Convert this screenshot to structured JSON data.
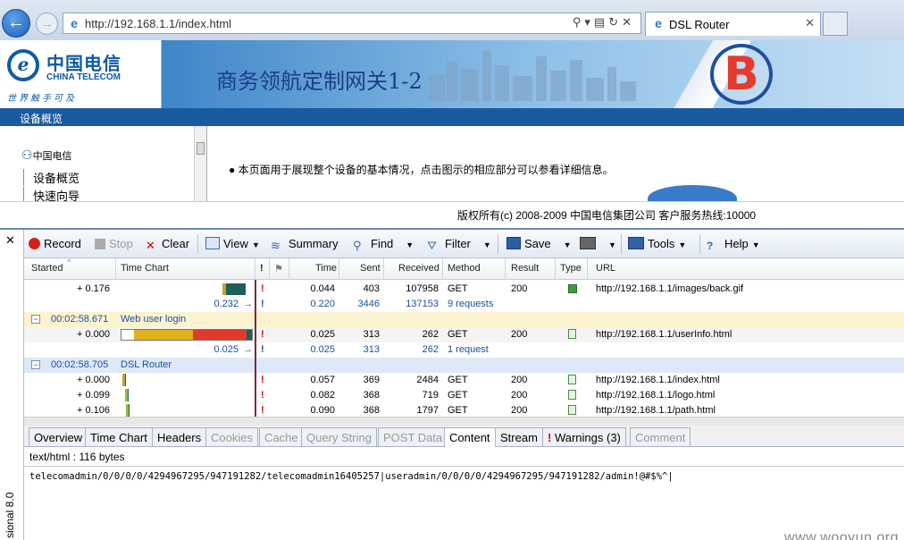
{
  "browser": {
    "url": "http://192.168.1.1/index.html",
    "tab_title": "DSL Router"
  },
  "router": {
    "logo_cn": "中国电信",
    "logo_en": "CHINA TELECOM",
    "logo_sub": "世界触手可及",
    "banner_title": "商务领航定制网关1-2",
    "nav_label": "设备概览",
    "sidebar": {
      "root": "中国电信",
      "items": [
        "设备概览",
        "快速向导"
      ]
    },
    "main_text": "本页面用于展现整个设备的基本情况，点击图示的相应部分可以参看详细信息。",
    "footer": "版权所有(c) 2008-2009 中国电信集团公司 客户服务热线:10000"
  },
  "fiddler": {
    "toolbar": {
      "record": "Record",
      "stop": "Stop",
      "clear": "Clear",
      "view": "View",
      "summary": "Summary",
      "find": "Find",
      "filter": "Filter",
      "save": "Save",
      "tools": "Tools",
      "help": "Help"
    },
    "columns": {
      "started": "Started",
      "time_chart": "Time Chart",
      "time": "Time",
      "sent": "Sent",
      "received": "Received",
      "method": "Method",
      "result": "Result",
      "type": "Type",
      "url": "URL"
    },
    "rows": [
      {
        "kind": "req",
        "started": "+ 0.176",
        "time": "0.044",
        "sent": "403",
        "received": "107958",
        "method": "GET",
        "result": "200",
        "url": "http://192.168.1.1/images/back.gif"
      },
      {
        "kind": "sum",
        "started": "0.232",
        "time": "0.220",
        "sent": "3446",
        "received": "137153",
        "method": "9 requests"
      },
      {
        "kind": "grp",
        "started": "00:02:58.671",
        "label": "Web user login"
      },
      {
        "kind": "req",
        "started": "+ 0.000",
        "time": "0.025",
        "sent": "313",
        "received": "262",
        "method": "GET",
        "result": "200",
        "url": "http://192.168.1.1/userInfo.html"
      },
      {
        "kind": "sum",
        "started": "0.025",
        "time": "0.025",
        "sent": "313",
        "received": "262",
        "method": "1 request"
      },
      {
        "kind": "grp2",
        "started": "00:02:58.705",
        "label": "DSL Router"
      },
      {
        "kind": "req",
        "started": "+ 0.000",
        "time": "0.057",
        "sent": "369",
        "received": "2484",
        "method": "GET",
        "result": "200",
        "url": "http://192.168.1.1/index.html"
      },
      {
        "kind": "req",
        "started": "+ 0.099",
        "time": "0.082",
        "sent": "368",
        "received": "719",
        "method": "GET",
        "result": "200",
        "url": "http://192.168.1.1/logo.html"
      },
      {
        "kind": "req",
        "started": "+ 0.106",
        "time": "0.090",
        "sent": "368",
        "received": "1797",
        "method": "GET",
        "result": "200",
        "url": "http://192.168.1.1/path.html"
      }
    ],
    "tabs": [
      "Overview",
      "Time Chart",
      "Headers",
      "Cookies",
      "Cache",
      "Query String",
      "POST Data",
      "Content",
      "Stream",
      "Warnings (3)",
      "Comment"
    ],
    "content_type": "text/html : 116 bytes",
    "content": "telecomadmin/0/0/0/0/4294967295/947191282/telecomadmin16405257|useradmin/0/0/0/0/4294967295/947191282/admin!@#$%^|",
    "side_label": "sional 8.0"
  },
  "watermark": "www.wooyun.org"
}
